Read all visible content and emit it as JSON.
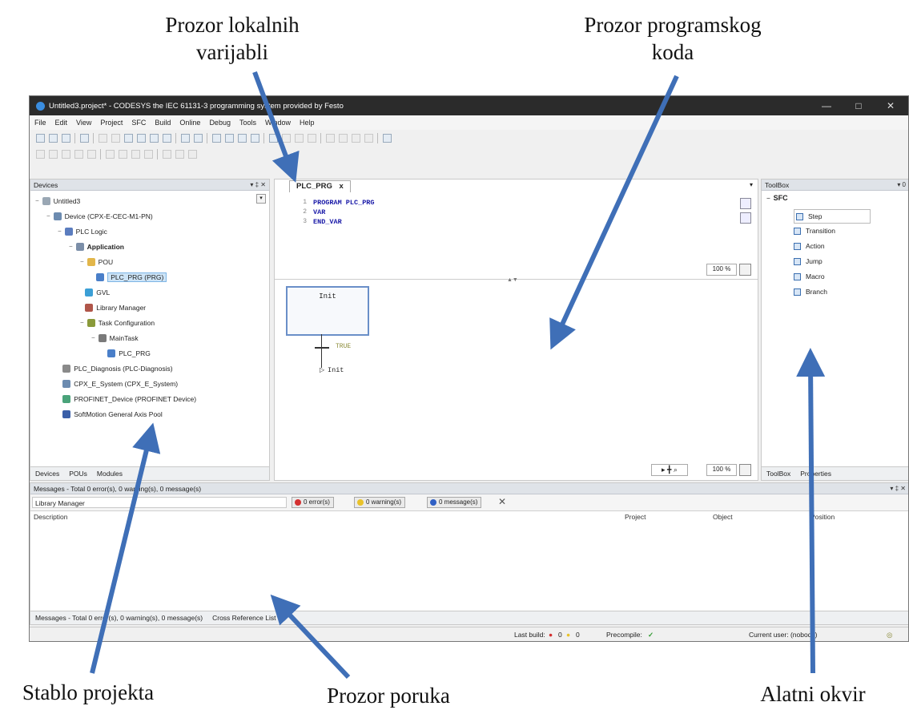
{
  "captions": {
    "local_vars": [
      "Prozor lokalnih",
      "varijabli"
    ],
    "program_code": [
      "Prozor programskog",
      "koda"
    ],
    "project_tree": "Stablo projekta",
    "messages": "Prozor poruka",
    "toolbox": "Alatni okvir"
  },
  "window": {
    "title": "Untitled3.project* - CODESYS the IEC 61131-3 programming system provided by Festo",
    "controls": [
      "—",
      "□",
      "✕"
    ]
  },
  "menu": [
    "File",
    "Edit",
    "View",
    "Project",
    "SFC",
    "Build",
    "Online",
    "Debug",
    "Tools",
    "Window",
    "Help"
  ],
  "devices_panel": {
    "title": "Devices",
    "controls": "▾ ‡ ✕",
    "tree": [
      {
        "label": "Untitled3",
        "indent": 0,
        "exp": "−"
      },
      {
        "label": "Device (CPX-E-CEC-M1-PN)",
        "indent": 1,
        "exp": "−"
      },
      {
        "label": "PLC Logic",
        "indent": 2,
        "exp": "−"
      },
      {
        "label": "Application",
        "indent": 3,
        "exp": "−"
      },
      {
        "label": "POU",
        "indent": 4,
        "exp": "−"
      },
      {
        "label": "PLC_PRG (PRG)",
        "indent": 5,
        "exp": ""
      },
      {
        "label": "GVL",
        "indent": 4,
        "exp": ""
      },
      {
        "label": "Library Manager",
        "indent": 4,
        "exp": ""
      },
      {
        "label": "Task Configuration",
        "indent": 4,
        "exp": "−"
      },
      {
        "label": "MainTask",
        "indent": 5,
        "exp": "−"
      },
      {
        "label": "PLC_PRG",
        "indent": 6,
        "exp": ""
      },
      {
        "label": "PLC_Diagnosis (PLC-Diagnosis)",
        "indent": 2,
        "exp": ""
      },
      {
        "label": "CPX_E_System (CPX_E_System)",
        "indent": 2,
        "exp": ""
      },
      {
        "label": "PROFINET_Device (PROFINET Device)",
        "indent": 2,
        "exp": ""
      },
      {
        "label": "SoftMotion General Axis Pool",
        "indent": 2,
        "exp": ""
      }
    ],
    "bottom_tabs": [
      "Devices",
      "POUs",
      "Modules"
    ]
  },
  "editor": {
    "tab_label": "PLC_PRG",
    "tab_close": "x",
    "line_numbers": [
      "1",
      "2",
      "3"
    ],
    "code_lines": [
      "PROGRAM PLC_PRG",
      "VAR",
      "END_VAR"
    ],
    "code_zoom": "100 %",
    "sfc": {
      "init_step": "Init",
      "transition": "TRUE",
      "jump": "Init"
    },
    "diagram_zoom": "100 %"
  },
  "toolbox_panel": {
    "title": "ToolBox",
    "category": "SFC",
    "items": [
      "Step",
      "Transition",
      "Action",
      "Jump",
      "Macro",
      "Branch"
    ],
    "bottom_tabs": [
      "ToolBox",
      "Properties"
    ]
  },
  "messages_panel": {
    "title": "Messages - Total 0 error(s), 0 warning(s), 0 message(s)",
    "filter": "Library Manager",
    "errors": "0 error(s)",
    "warnings": "0 warning(s)",
    "messages": "0 message(s)",
    "columns": [
      "Description",
      "Project",
      "Object",
      "Position"
    ],
    "bottom_tabs": [
      "Messages - Total 0 error(s), 0 warning(s), 0 message(s)",
      "Cross Reference List"
    ]
  },
  "statusbar": {
    "last_build": "Last build:",
    "errors": "0",
    "warnings": "0",
    "precompile": "Precompile:",
    "current_user": "Current user: (nobody)"
  },
  "colors": {
    "arrow": "#3f6fb7",
    "titlebar": "#2b2b2b",
    "keyword": "#1a1aa8",
    "selection": "#cde4f7"
  }
}
